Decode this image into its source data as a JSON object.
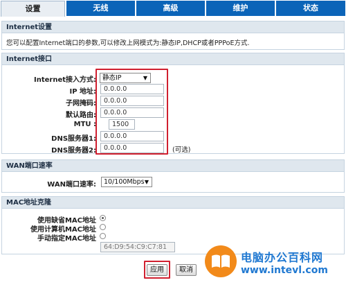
{
  "tabs": [
    {
      "label": "设置",
      "active": true
    },
    {
      "label": "无线",
      "active": false
    },
    {
      "label": "高级",
      "active": false
    },
    {
      "label": "维护",
      "active": false
    },
    {
      "label": "状态",
      "active": false
    }
  ],
  "internet_settings": {
    "title": "Internet设置",
    "description": "您可以配置Internet端口的参数,可以修改上网模式为:静态IP,DHCP或者PPPoE方式."
  },
  "internet_port": {
    "title": "Internet接口",
    "mode_label": "Internet接入方式:",
    "mode_value": "静态IP",
    "ip_label": "IP 地址:",
    "ip_value": "0.0.0.0",
    "mask_label": "子网掩码:",
    "mask_value": "0.0.0.0",
    "gateway_label": "默认路由:",
    "gateway_value": "0.0.0.0",
    "mtu_label": "MTU :",
    "mtu_value": "1500",
    "dns1_label": "DNS服务器1:",
    "dns1_value": "0.0.0.0",
    "dns2_label": "DNS服务器2:",
    "dns2_value": "0.0.0.0",
    "optional_note": "(可选)"
  },
  "wan_speed": {
    "title": "WAN端口速率",
    "label": "WAN端口速率:",
    "value": "10/100Mbps"
  },
  "mac_clone": {
    "title": "MAC地址克隆",
    "opt_default": "使用缺省MAC地址",
    "opt_computer": "使用计算机MAC地址",
    "opt_manual": "手动指定MAC地址",
    "selected": "default",
    "mac_value": "64:D9:54:C9:C7:81"
  },
  "buttons": {
    "apply": "应用",
    "cancel": "取消"
  },
  "watermark": {
    "name": "电脑办公百科网",
    "url": "www.intevl.com"
  },
  "colors": {
    "tab_blue": "#0b64b8",
    "highlight_red": "#d01f2f",
    "watermark_blue": "#1f78d1"
  }
}
